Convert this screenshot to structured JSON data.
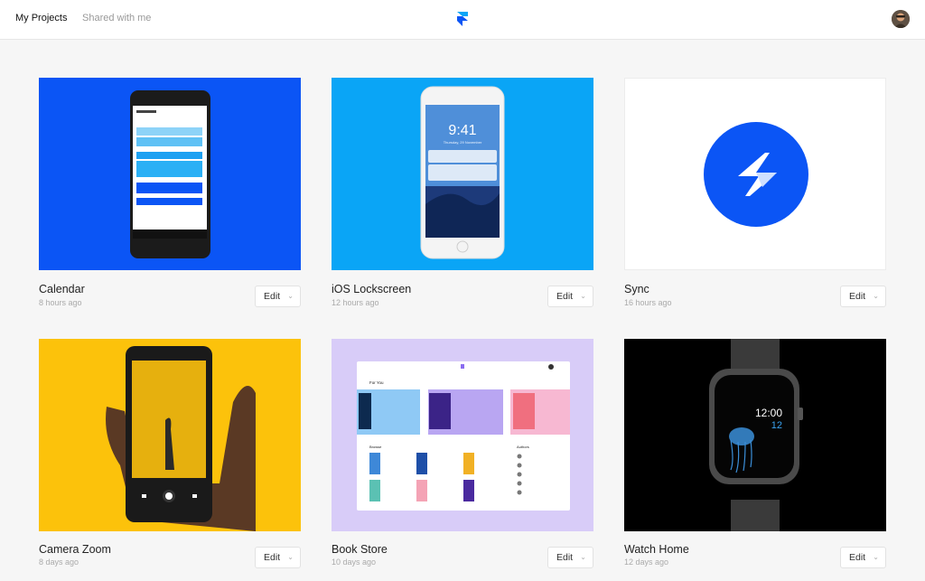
{
  "header": {
    "tabs": [
      {
        "label": "My Projects",
        "active": true
      },
      {
        "label": "Shared with me",
        "active": false
      }
    ],
    "logo_icon": "framer-logo-icon",
    "avatar_icon": "user-avatar"
  },
  "projects": [
    {
      "title": "Calendar",
      "time": "8 hours ago",
      "edit": "Edit",
      "thumb_color": "#0b55f5"
    },
    {
      "title": "iOS Lockscreen",
      "time": "12 hours ago",
      "edit": "Edit",
      "thumb_color": "#0aa5f6",
      "thumb_text": {
        "time": "9:41",
        "date": "Thursday, 29 November"
      }
    },
    {
      "title": "Sync",
      "time": "16 hours ago",
      "edit": "Edit",
      "thumb_color": "#ffffff",
      "icon": "sync-bolt-icon"
    },
    {
      "title": "Camera Zoom",
      "time": "8 days ago",
      "edit": "Edit",
      "thumb_color": "#fcc20b"
    },
    {
      "title": "Book Store",
      "time": "10 days ago",
      "edit": "Edit",
      "thumb_color": "#d8ccf8",
      "thumb_text": {
        "section1": "For You",
        "section2": "Browse",
        "section3": "Authors"
      }
    },
    {
      "title": "Watch Home",
      "time": "12 days ago",
      "edit": "Edit",
      "thumb_color": "#000000",
      "thumb_text": {
        "hour": "12:00",
        "date": "12"
      }
    }
  ],
  "colors": {
    "accent": "#0b55f5",
    "background": "#f6f6f6"
  }
}
